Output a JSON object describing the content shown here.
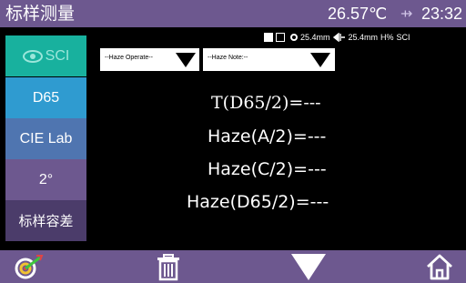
{
  "header": {
    "title": "标样测量",
    "temperature": "26.57℃",
    "usb_symbol": "⇸",
    "time": "23:32"
  },
  "options_bar": {
    "aperture_1": "25.4mm",
    "aperture_2": "25.4mm",
    "mode": "H%",
    "spec": "SCI"
  },
  "sidebar": {
    "items": [
      {
        "label": "SCI"
      },
      {
        "label": "D65"
      },
      {
        "label": "CIE Lab"
      },
      {
        "label": "2°"
      },
      {
        "label": "标样容差"
      }
    ]
  },
  "dropdowns": {
    "haze_operate": "--Haze Operate--",
    "haze_note": "--Haze Note:--"
  },
  "results": [
    {
      "text": "T(D65/2)=---"
    },
    {
      "text": "Haze(A/2)=---"
    },
    {
      "text": "Haze(C/2)=---"
    },
    {
      "text": "Haze(D65/2)=---"
    }
  ],
  "colors": {
    "bar": "#6d588f",
    "sci": "#18b19e",
    "d65": "#2f9bd0",
    "cielab": "#4f75b0",
    "observer": "#6d588f",
    "tolerance": "#4b3c6a"
  },
  "bottom_bar": {
    "icons": [
      "target-icon",
      "trash-icon",
      "down-arrow-icon",
      "home-icon"
    ]
  }
}
